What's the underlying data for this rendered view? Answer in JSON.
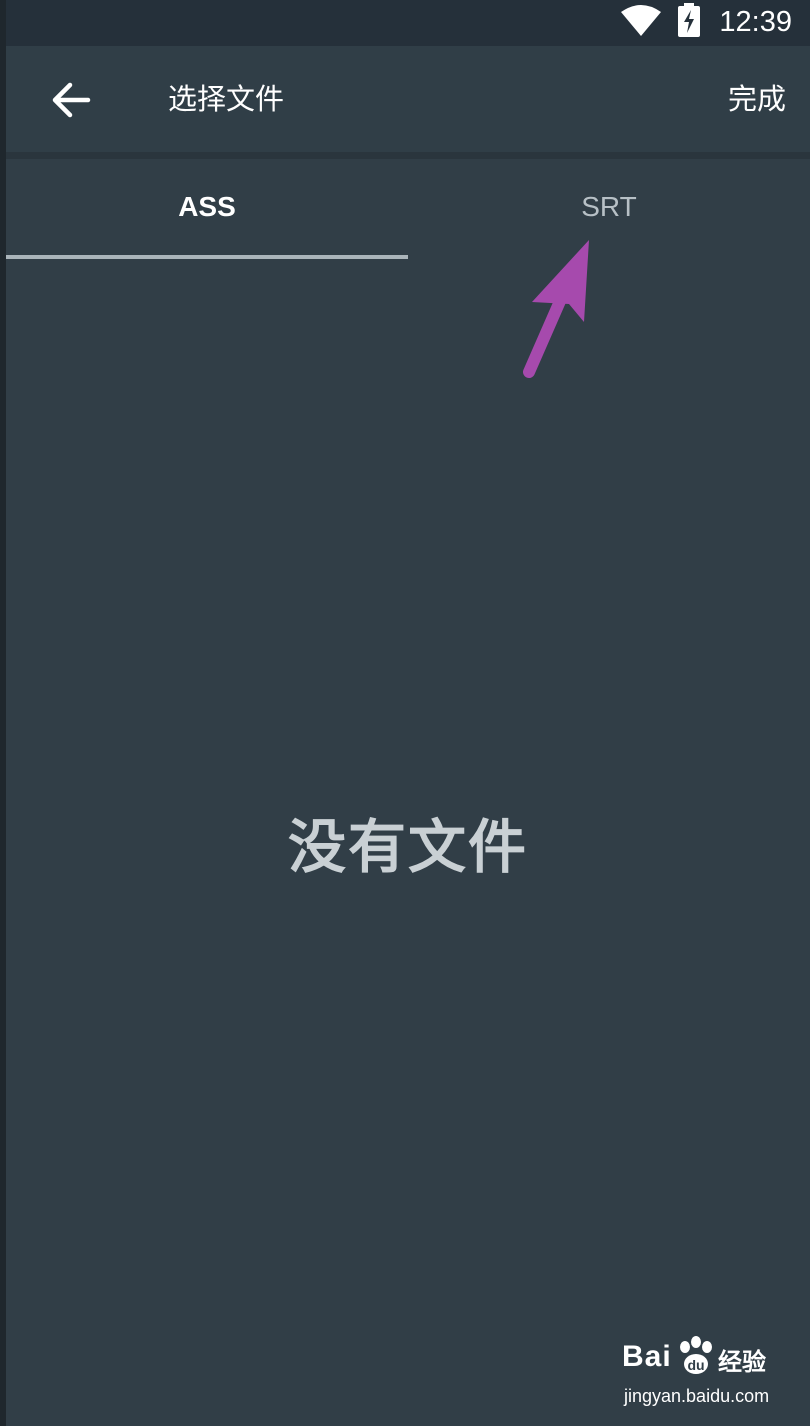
{
  "status_bar": {
    "time": "12:39",
    "icons": [
      "wifi-icon",
      "battery-charging-icon"
    ]
  },
  "app_bar": {
    "back_icon": "arrow-back-icon",
    "title": "选择文件",
    "done_label": "完成"
  },
  "tabs": [
    {
      "label": "ASS",
      "selected": true
    },
    {
      "label": "SRT",
      "selected": false
    }
  ],
  "empty_state": {
    "message": "没有文件"
  },
  "annotation": {
    "icon": "arrow-pointer-icon",
    "color": "#a64aad"
  },
  "watermark": {
    "logo": "Bai",
    "logo_suffix": "经验",
    "url": "jingyan.baidu.com"
  },
  "colors": {
    "background": "#313e47",
    "status_bar": "#25303a",
    "text_primary": "#ffffff",
    "text_secondary": "#b7c0c6",
    "indicator": "#aab4ba"
  }
}
